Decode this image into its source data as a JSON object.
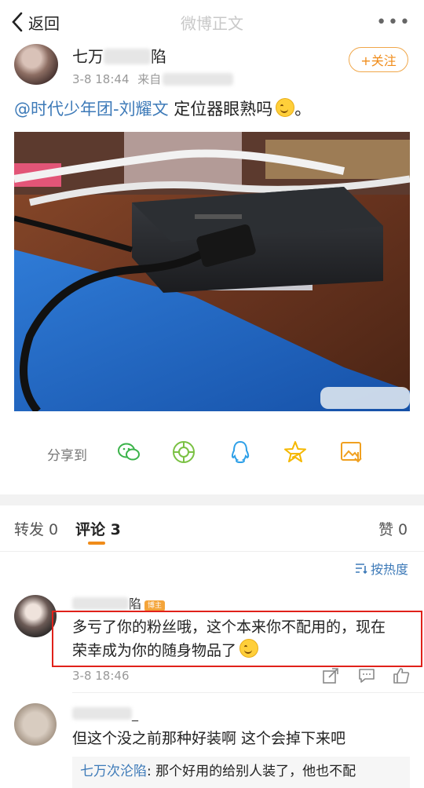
{
  "nav": {
    "back_label": "返回",
    "title": "微博正文",
    "more": "•••"
  },
  "post": {
    "author_visible": "七万",
    "author_tail": "陷",
    "time": "3-8 18:44",
    "source_prefix": "来自",
    "follow_label": "+关注",
    "mention": "@时代少年团-刘耀文",
    "text": " 定位器眼熟吗",
    "text_end": "。"
  },
  "share": {
    "label": "分享到",
    "icons": [
      "wechat-icon",
      "moments-icon",
      "qq-icon",
      "qzone-icon",
      "save-image-icon"
    ]
  },
  "tabs": {
    "repost": "转发 0",
    "comments": "评论 3",
    "likes": "赞 0",
    "sort_label": "按热度"
  },
  "comments": [
    {
      "name_tail": "陷",
      "badge": "博主",
      "text_line1": "多亏了你的粉丝哦，这个本来你不配用的，现在",
      "text_line2": "荣幸成为你的随身物品了",
      "time": "3-8 18:46"
    },
    {
      "name_tail": "_",
      "text": "但这个没之前那种好装啊 这个会掉下来吧",
      "reply_name": "七万次沦陷",
      "reply_text": ": 那个好用的给别人装了，他也不配"
    }
  ],
  "colors": {
    "accent": "#f08c1a",
    "link": "#3d7ab8",
    "highlight": "#e0211a"
  }
}
